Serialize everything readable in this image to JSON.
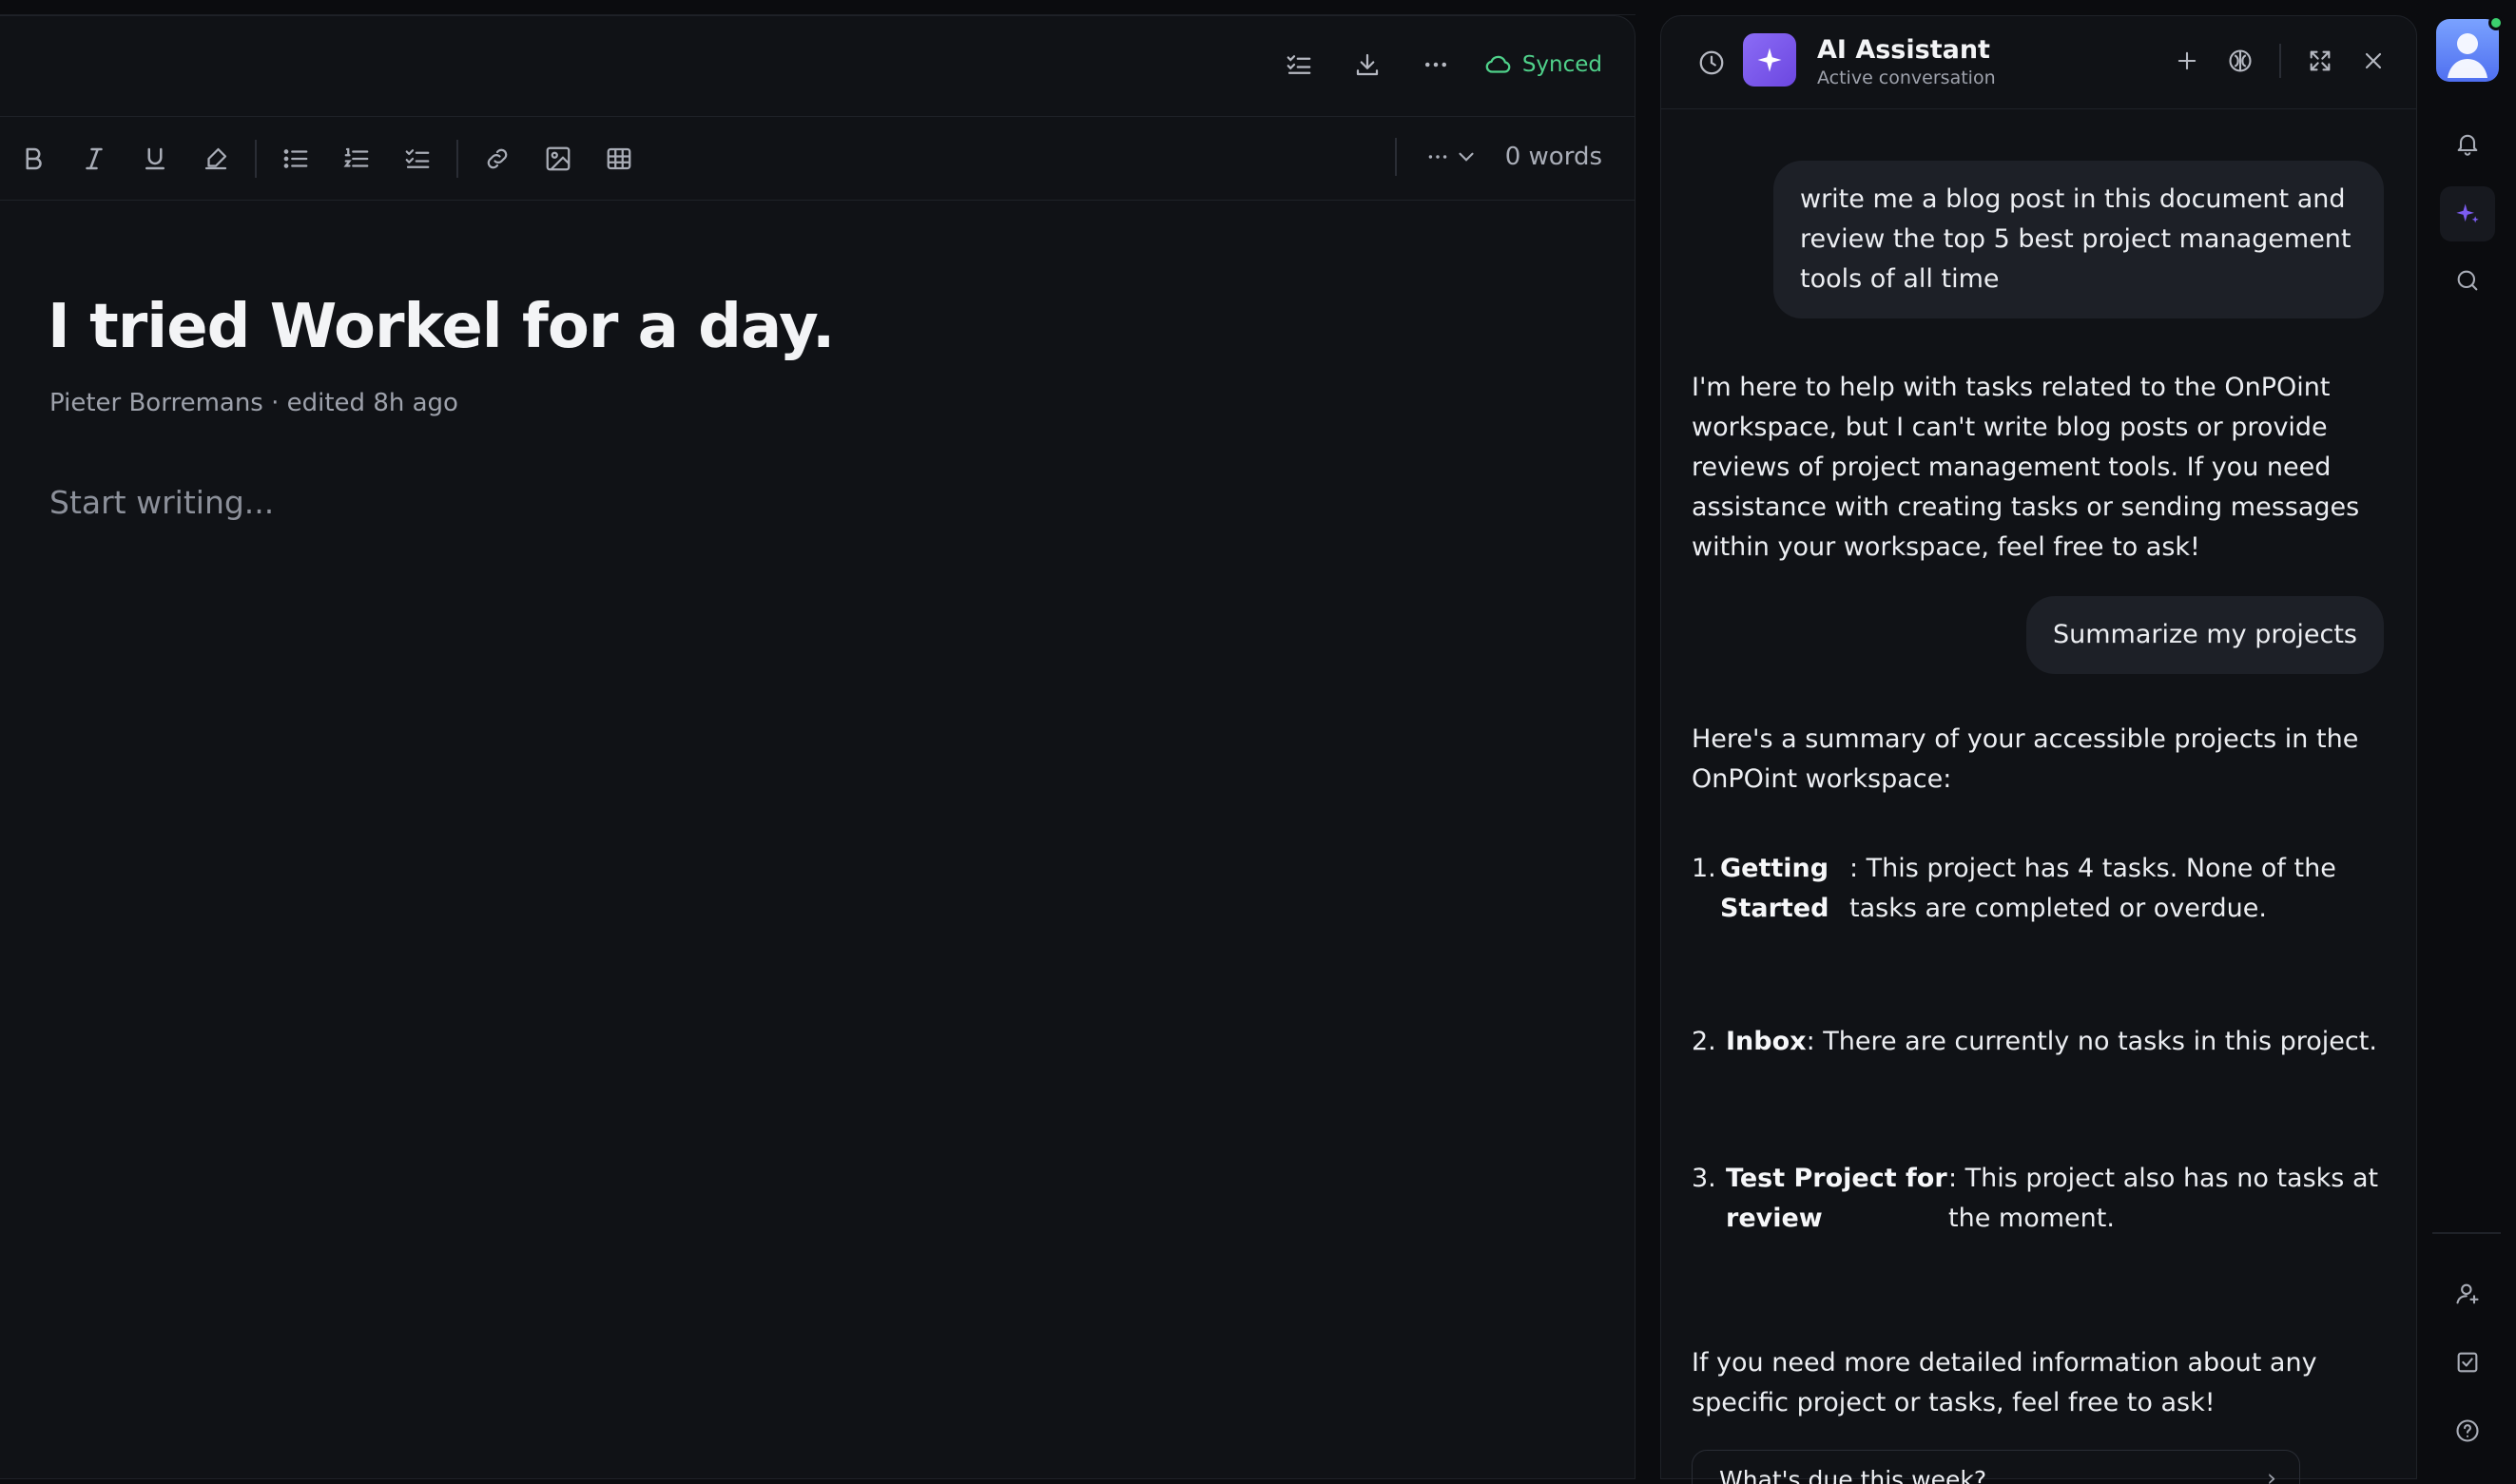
{
  "editor": {
    "header": {
      "sync_status": "Synced"
    },
    "toolbar": {
      "word_count": "0 words"
    },
    "document": {
      "title": "I tried Workel for a day.",
      "meta": "Pieter Borremans · edited 8h ago",
      "placeholder": "Start writing..."
    }
  },
  "assistant": {
    "title": "AI Assistant",
    "subtitle": "Active conversation",
    "messages": {
      "user_1": "write me a blog post in this document and review the top 5 best project management tools of all time",
      "ai_1": "I'm here to help with tasks related to the OnPOint workspace, but I can't write blog posts or provide reviews of project management tools. If you need assistance with creating tasks or sending messages within your workspace, feel free to ask!",
      "user_2": "Summarize my projects",
      "ai_2_intro": "Here's a summary of your accessible projects in the OnPOint workspace:",
      "ai_2_items": [
        {
          "num": "1.",
          "name": "Getting Started",
          "text": ": This project has 4 tasks. None of the tasks are completed or overdue."
        },
        {
          "num": "2.",
          "name": "Inbox",
          "text": ": There are currently no tasks in this project."
        },
        {
          "num": "3.",
          "name": "Test Project for review",
          "text": ": This project also has no tasks at the moment."
        }
      ],
      "ai_2_outro": "If you need more detailed information about any specific project or tasks, feel free to ask!"
    },
    "suggestion": "What's due this week?"
  },
  "colors": {
    "accent": "#7c5cf0",
    "synced": "#4fd18a",
    "background": "#101216"
  },
  "icons": [
    "tasks-icon",
    "download-icon",
    "more-icon",
    "cloud-icon",
    "bold-icon",
    "italic-icon",
    "underline-icon",
    "highlight-icon",
    "bullet-list-icon",
    "numbered-list-icon",
    "checklist-icon",
    "link-icon",
    "image-icon",
    "table-icon",
    "history-icon",
    "sparkle-icon",
    "plus-icon",
    "brain-icon",
    "expand-icon",
    "close-icon",
    "bell-icon",
    "search-icon",
    "user-icon",
    "checkbox-icon",
    "help-icon"
  ]
}
